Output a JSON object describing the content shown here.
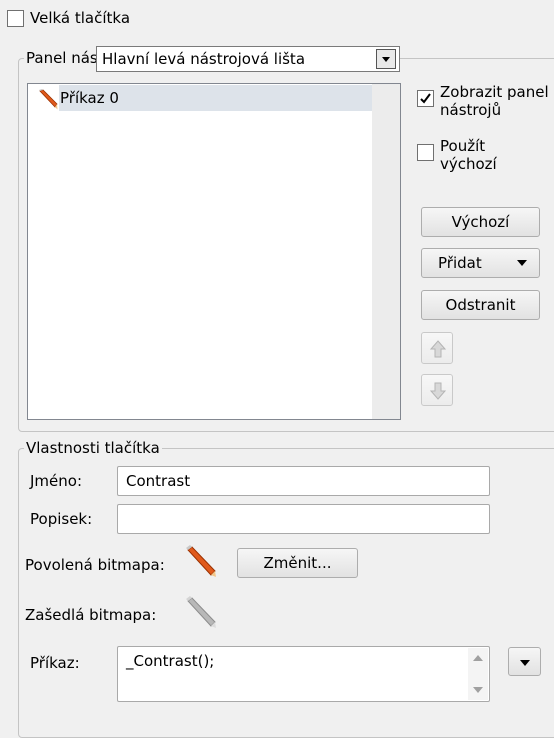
{
  "big_buttons": {
    "label": "Velká tlačítka",
    "checked": false
  },
  "toolbar_panel": {
    "legend": "Panel nás",
    "selected_toolbar": "Hlavní levá nástrojová lišta",
    "items": [
      {
        "label": "Příkaz 0",
        "icon": "pencil-icon"
      }
    ],
    "show_toolbar": {
      "label_line1": "Zobrazit panel",
      "label_line2": "nástrojů",
      "checked": true
    },
    "use_default": {
      "label_line1": "Použít",
      "label_line2": "výchozí",
      "checked": false
    },
    "buttons": {
      "default": "Výchozí",
      "add": "Přidat",
      "remove": "Odstranit"
    }
  },
  "button_properties": {
    "legend": "Vlastnosti tlačítka",
    "name_label": "Jméno:",
    "name_value": "Contrast",
    "caption_label": "Popisek:",
    "caption_value": "",
    "enabled_bitmap_label": "Povolená bitmapa:",
    "change_button": "Změnit...",
    "disabled_bitmap_label": "Zašedlá bitmapa:",
    "command_label": "Příkaz:",
    "command_value": "_Contrast();"
  }
}
